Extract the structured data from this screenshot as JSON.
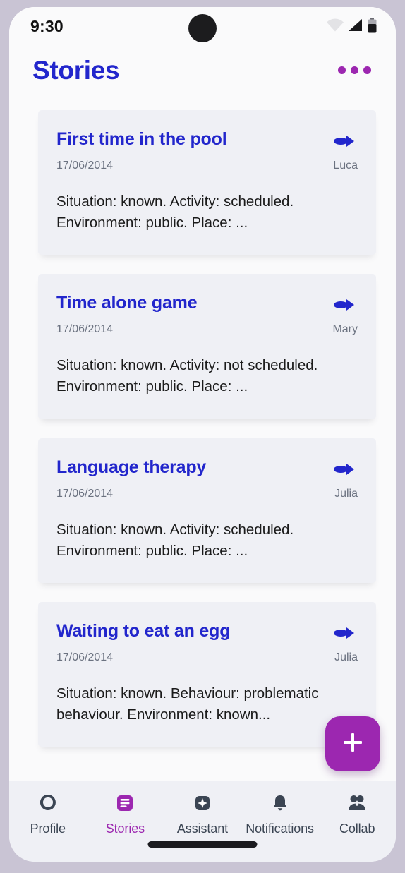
{
  "status_bar": {
    "time": "9:30",
    "icons": [
      "wifi-icon",
      "cellular-signal-icon",
      "battery-icon"
    ]
  },
  "app_bar": {
    "title": "Stories",
    "overflow_icon": "more-horizontal-icon"
  },
  "theme": {
    "accent_blue": "#2226cc",
    "accent_purple": "#9c27b0",
    "card_bg": "#eff0f5",
    "page_bg": "#fafafb",
    "muted_text": "#6b7280",
    "nav_icon": "#3b4553"
  },
  "stories": [
    {
      "title": "First time in the pool",
      "date": "17/06/2014",
      "author": "Luca",
      "summary": "Situation: known. Activity: scheduled.\nEnvironment: public. Place: ...",
      "arrow_icon": "arrow-right-icon"
    },
    {
      "title": "Time alone game",
      "date": "17/06/2014",
      "author": "Mary",
      "summary": "Situation: known. Activity: not scheduled.\nEnvironment: public. Place: ...",
      "arrow_icon": "arrow-right-icon"
    },
    {
      "title": "Language therapy",
      "date": "17/06/2014",
      "author": "Julia",
      "summary": "Situation: known. Activity: scheduled.\nEnvironment: public. Place: ...",
      "arrow_icon": "arrow-right-icon"
    },
    {
      "title": "Waiting to eat an egg",
      "date": "17/06/2014",
      "author": "Julia",
      "summary": "Situation: known. Behaviour: problematic\nbehaviour. Environment: known...",
      "arrow_icon": "arrow-right-icon"
    }
  ],
  "fab": {
    "label": "+",
    "icon": "plus-icon"
  },
  "bottom_nav": {
    "active": "Stories",
    "items": [
      {
        "label": "Profile",
        "icon": "profile-icon"
      },
      {
        "label": "Stories",
        "icon": "stories-icon"
      },
      {
        "label": "Assistant",
        "icon": "assistant-sparkle-icon"
      },
      {
        "label": "Notifications",
        "icon": "bell-icon"
      },
      {
        "label": "Collab",
        "icon": "people-group-icon"
      }
    ]
  }
}
